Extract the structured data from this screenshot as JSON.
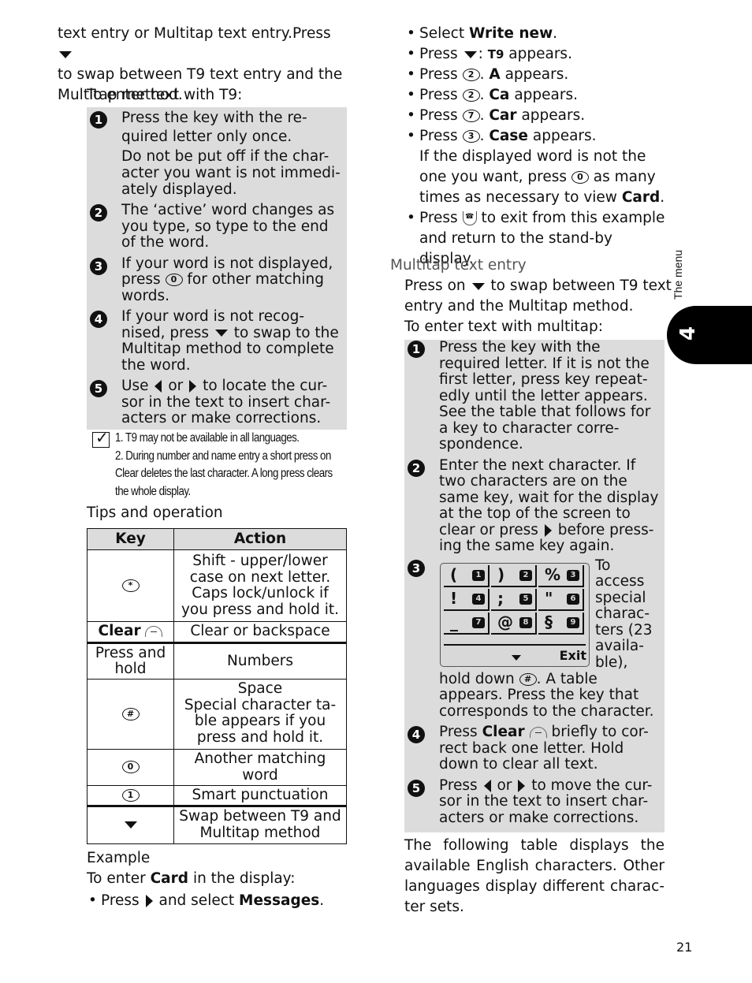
{
  "left_column": {
    "intro_line1": "text entry or Multitap text entry.Press",
    "intro_line2": "to swap between T9 text entry and the",
    "intro_line3": "Multitap method.",
    "t9_heading": "To enter text with T9:",
    "t9_steps": [
      {
        "num": "1",
        "lines": [
          "Press the key with the re-",
          "quired letter only once."
        ],
        "extra": [
          "Do not be put off if the char-",
          "acter you want is not immedi-",
          "ately displayed."
        ]
      },
      {
        "num": "2",
        "lines": [
          "The ‘active’ word changes as",
          "you type, so type to the end",
          "of the word."
        ]
      },
      {
        "num": "3",
        "pre": "If your word is not displayed,",
        "line2_pre": "press",
        "key": "0",
        "line2_post": "for other matching",
        "line3": "words."
      },
      {
        "num": "4",
        "line1": "If your word is not recog-",
        "line2_pre": "nised, press",
        "line2_post": "to swap to the",
        "line3": "Multitap method to complete",
        "line4": "the word."
      },
      {
        "num": "5",
        "line1_pre": "Use",
        "line1_mid": "or",
        "line1_post": "to locate the cur-",
        "line2": "sor in the text to insert char-",
        "line3": "acters or make corrections."
      }
    ],
    "note_icon": "checkmark-icon",
    "note_lines": [
      "1. T9 may not be available in all languages.",
      "2. During number and name entry a short press on",
      "Clear deletes the last character. A long press clears",
      "the whole display."
    ],
    "tips_heading": "Tips and operation",
    "tips_table": {
      "headers": [
        "Key",
        "Action"
      ],
      "rows": [
        {
          "key": "*",
          "action": [
            "Shift - upper/lower",
            "case on next letter.",
            "Caps lock/unlock if",
            "you press and hold it."
          ]
        },
        {
          "key": "Clear",
          "action": [
            "Clear or backspace"
          ]
        },
        {
          "key": "Press and hold",
          "action": [
            "Numbers"
          ]
        },
        {
          "key": "#",
          "action": [
            "Space",
            "Special character ta-",
            "ble appears if you",
            "press and hold it."
          ]
        },
        {
          "key": "0",
          "action": [
            "Another matching",
            "word"
          ]
        },
        {
          "key": "1",
          "action": [
            "Smart punctuation"
          ]
        },
        {
          "key": "down-arrow",
          "action": [
            "Swap between T9 and",
            "Multitap method"
          ]
        }
      ]
    },
    "example_heading": "Example",
    "example_line_pre": "To enter",
    "example_bold": "Card",
    "example_line_post": "in the display:",
    "example_bullet_pre": "Press",
    "example_bullet_mid": "and select",
    "example_bullet_bold": "Messages"
  },
  "right_column": {
    "bullets": [
      {
        "pre": "Select",
        "bold": "Write new",
        "post": "."
      },
      {
        "pre": "Press",
        "key": "down-arrow",
        "mid": ":",
        "icon": "T9",
        "post": "appears."
      },
      {
        "pre": "Press",
        "key": "2",
        "bold": "A",
        "post": "appears."
      },
      {
        "pre": "Press",
        "key": "2",
        "bold": "Ca",
        "post": "appears."
      },
      {
        "pre": "Press",
        "key": "7",
        "bold": "Car",
        "post": "appears."
      },
      {
        "pre": "Press",
        "key": "3",
        "bold": "Case",
        "post": "appears."
      }
    ],
    "case_follow": [
      "If the displayed word is not the",
      "one you want, press",
      "as many",
      "times as necessary to view",
      "Card"
    ],
    "exit_bullet": [
      "Press",
      "to exit from this example",
      "and return to the stand-by display."
    ],
    "multitap_heading": "Multitap text entry",
    "multitap_intro1_pre": "Press on",
    "multitap_intro1_post": "to swap between T9 text",
    "multitap_intro2": "entry and the Multitap method.",
    "multitap_intro3": "To enter text with multitap:",
    "mt_step1": [
      "Press the key with the",
      "required letter. If it is not the",
      "first letter, press key repeat-",
      "edly until the letter appears.",
      "See the table that follows for",
      "a key to character corre-",
      "spondence."
    ],
    "mt_step2": [
      "Enter the next character. If",
      "two characters are on the",
      "same key, wait for the display",
      "at the top of the screen to",
      "clear or press",
      "before press-",
      "ing the same key again."
    ],
    "mt_step3_side": [
      "To",
      "access",
      "special",
      "charac-",
      "ters (23",
      "availa-",
      "ble),"
    ],
    "mt_step3_below": [
      "hold down",
      ". A table",
      "appears. Press the key that",
      "corresponds to the character."
    ],
    "mt_step4": [
      "Press",
      "Clear",
      "briefly to cor-",
      "rect back one letter. Hold",
      "down to clear all text."
    ],
    "mt_step5": [
      "Press",
      "or",
      "to move the cur-",
      "sor in the text to insert char-",
      "acters or make corrections."
    ],
    "closing": [
      "The following table displays the",
      "available English characters. Other",
      "languages display different charac-",
      "ter sets."
    ],
    "phone_display": {
      "cells": [
        {
          "ch": "(",
          "key": "1"
        },
        {
          "ch": ")",
          "key": "2"
        },
        {
          "ch": "%",
          "key": "3"
        },
        {
          "ch": "!",
          "key": "4"
        },
        {
          "ch": ";",
          "key": "5"
        },
        {
          "ch": "\"",
          "key": "6"
        },
        {
          "ch": "_",
          "key": "7"
        },
        {
          "ch": "@",
          "key": "8"
        },
        {
          "ch": "§",
          "key": "9"
        }
      ],
      "softkey": "Exit"
    }
  },
  "side_tab": {
    "label": "The menu",
    "chapter": "4"
  },
  "page_number": "21"
}
